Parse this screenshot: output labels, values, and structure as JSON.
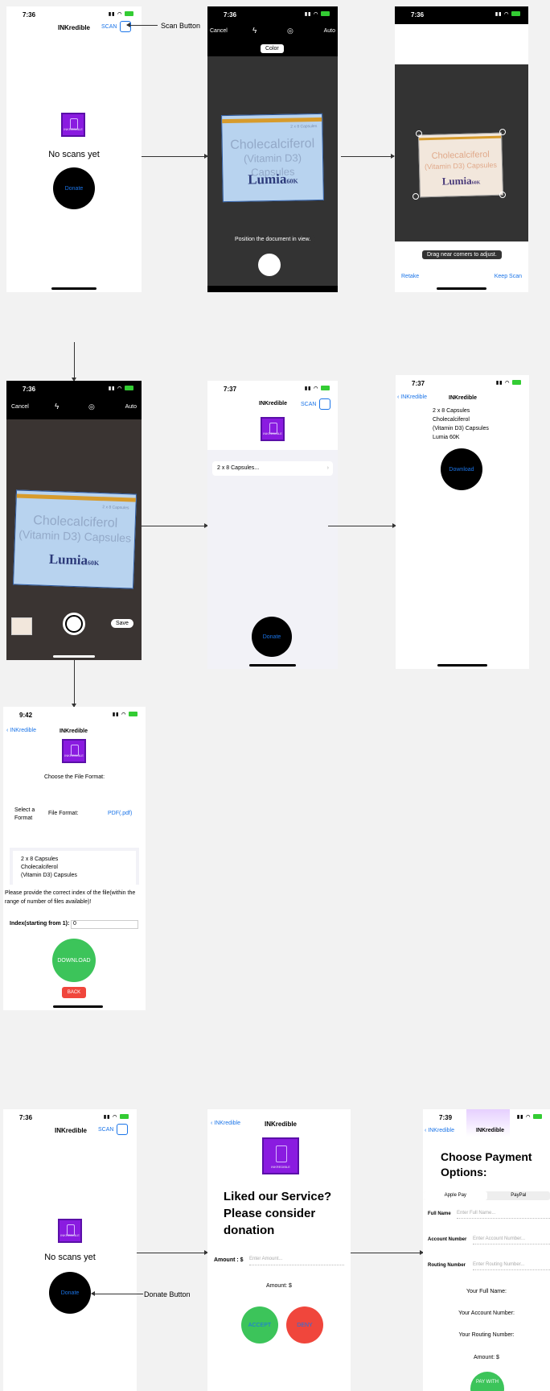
{
  "s1": {
    "time": "7:36",
    "title": "INKredible",
    "scan": "SCAN",
    "icon_text": "INKREDIBLE",
    "empty": "No scans yet",
    "donate": "Donate"
  },
  "ann_scan": "Scan Button",
  "s2": {
    "time": "7:36",
    "cancel": "Cancel",
    "auto": "Auto",
    "color": "Color",
    "box1": "Cholecalciferol",
    "box2": "(Vitamin D3) Capsules",
    "brand": "Lumia",
    "brand_sfx": "60K",
    "small": "2 x 8 Capsules",
    "hint": "Position the document in view."
  },
  "s3": {
    "time": "7:36",
    "hint": "Drag near corners to adjust.",
    "retake": "Retake",
    "keep": "Keep Scan"
  },
  "s4": {
    "time": "7:36",
    "cancel": "Cancel",
    "auto": "Auto",
    "save": "Save"
  },
  "s5": {
    "time": "7:37",
    "title": "INKredible",
    "scan": "SCAN",
    "icon_text": "INKREDIBLE",
    "row": "2 x 8 Capsules...",
    "donate": "Donate"
  },
  "s6": {
    "time": "7:37",
    "back": "INKredible",
    "title": "INKredible",
    "lines": [
      "2 x 8 Capsules",
      "Cholecalciferol",
      "(Vitamin D3) Capsules",
      "Lumia 60K"
    ],
    "download": "Download"
  },
  "s7": {
    "time": "9:42",
    "back": "INKredible",
    "title": "INKredible",
    "icon_text": "INKREDIBLE",
    "choose": "Choose the File Format:",
    "select": "Select a Format",
    "file_format": "File Format:",
    "format_value": "PDF(.pdf)",
    "preview": [
      "2 x 8 Capsules",
      "Cholecalciferol",
      "(Vitamin D3) Capsules"
    ],
    "note": "Please provide the correct index of the file(within the range of number of files available)!",
    "index_label": "Index(starting from 1):",
    "index_value": "0",
    "download": "DOWNLOAD",
    "back_btn": "BACK"
  },
  "s8": {
    "time": "7:36",
    "title": "INKredible",
    "scan": "SCAN",
    "icon_text": "INKREDIBLE",
    "empty": "No scans yet",
    "donate": "Donate"
  },
  "ann_donate": "Donate Button",
  "s9": {
    "back": "INKredible",
    "title": "INKredible",
    "icon_text": "INKREDIBLE",
    "headline": "Liked our Service? Please consider donation",
    "amount_label": "Amount : $",
    "amount_ph": "Enter Amount...",
    "amount_show": "Amount: $",
    "accept": "ACCEPT",
    "deny": "DENY"
  },
  "s10": {
    "time": "7:39",
    "back": "INKredible",
    "title": "INKredible",
    "heading": "Choose Payment Options:",
    "tab1": "Apple Pay",
    "tab2": "PayPal",
    "full_name": "Full Name",
    "full_ph": "Enter Full Name...",
    "acct": "Account Number",
    "acct_ph": "Enter Account Number...",
    "routing": "Routing Number",
    "routing_ph": "Enter Routing Number...",
    "your_name": "Your Full Name:",
    "your_acct": "Your Account Number:",
    "your_routing": "Your Routing Number:",
    "amount": "Amount: $",
    "pay": "PAY WITH"
  },
  "colors": {
    "accent": "#1a74e8",
    "brand": "#8a1be0",
    "accept": "#3cc45a",
    "deny": "#f0463c"
  }
}
